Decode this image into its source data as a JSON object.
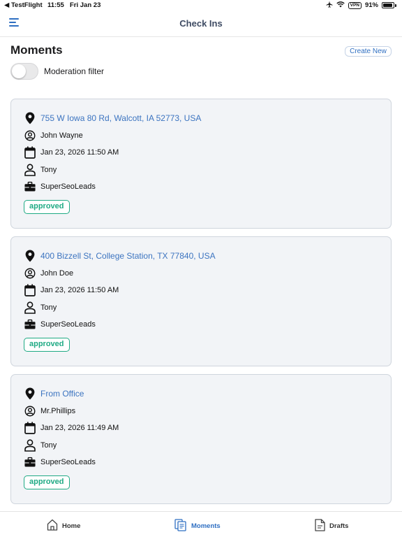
{
  "status_bar": {
    "back_app": "◀ TestFlight",
    "time": "11:55",
    "date": "Fri Jan 23",
    "vpn": "VPN",
    "battery": "91%"
  },
  "header": {
    "title": "Check Ins"
  },
  "page": {
    "title": "Moments",
    "create_button": "Create New",
    "filter_label": "Moderation filter",
    "filter_on": false
  },
  "checkins": [
    {
      "address": "755 W Iowa 80 Rd, Walcott, IA 52773, USA",
      "contact": "John Wayne",
      "datetime": "Jan 23, 2026 11:50 AM",
      "user": "Tony",
      "company": "SuperSeoLeads",
      "status": "approved"
    },
    {
      "address": "400 Bizzell St, College Station, TX 77840, USA",
      "contact": "John Doe",
      "datetime": "Jan 23, 2026 11:50 AM",
      "user": "Tony",
      "company": "SuperSeoLeads",
      "status": "approved"
    },
    {
      "address": "From Office",
      "contact": "Mr.Phillips",
      "datetime": "Jan 23, 2026 11:49 AM",
      "user": "Tony",
      "company": "SuperSeoLeads",
      "status": "approved"
    }
  ],
  "tabs": [
    {
      "label": "Home",
      "icon": "house-icon",
      "active": false
    },
    {
      "label": "Moments",
      "icon": "moments-document-icon",
      "active": true
    },
    {
      "label": "Drafts",
      "icon": "drafts-document-icon",
      "active": false
    }
  ],
  "colors": {
    "accent": "#2f6fc2",
    "approved": "#1faa84",
    "card_bg": "#f2f4f7"
  }
}
